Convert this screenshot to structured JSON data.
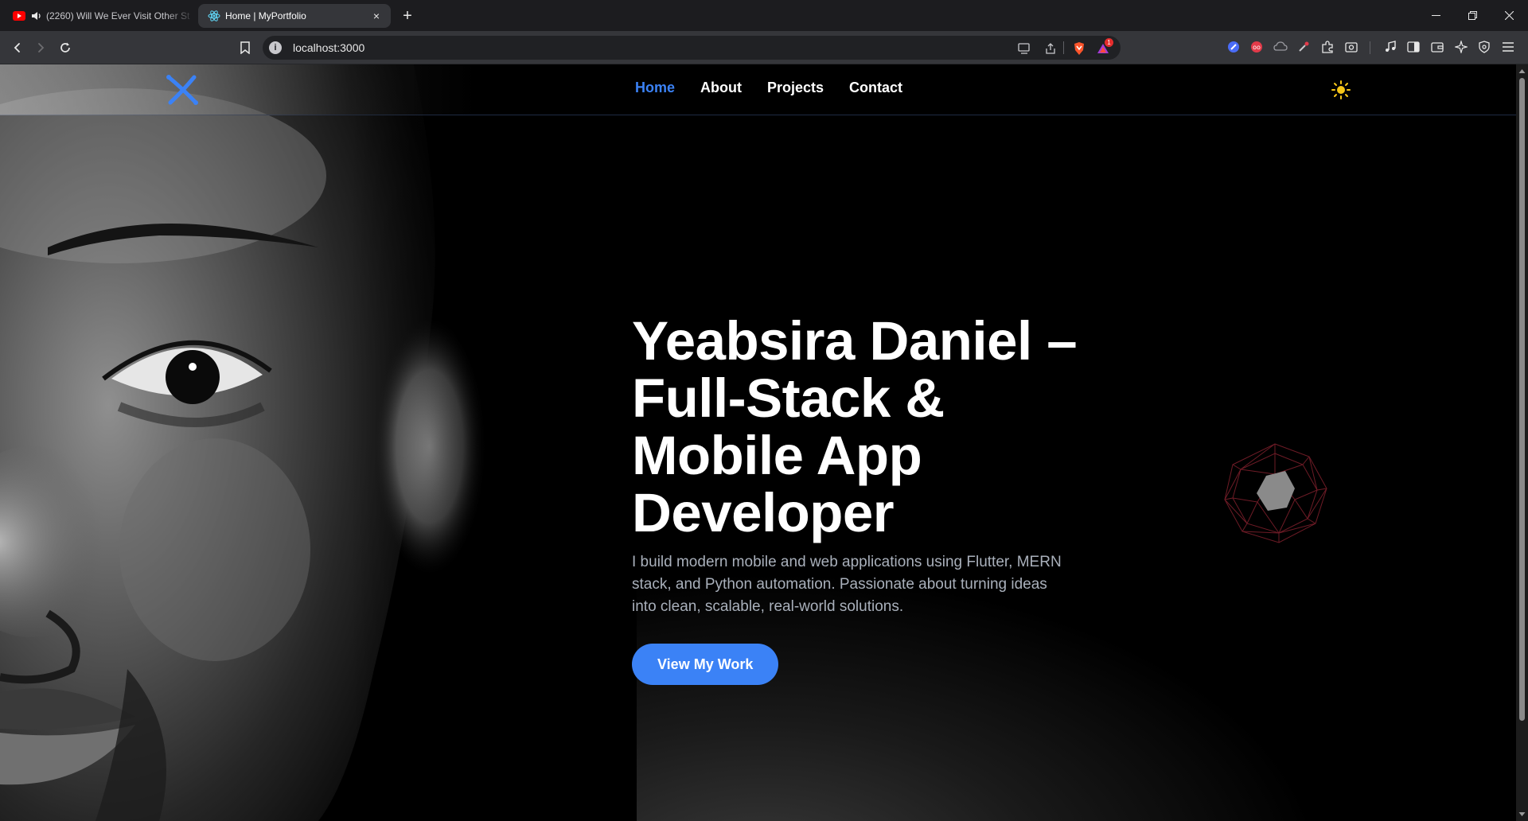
{
  "browser": {
    "tabs": [
      {
        "title": "(2260) Will We Ever Visit Other St",
        "icon": "youtube-icon",
        "audio_icon": "speaker-icon"
      },
      {
        "title": "Home | MyPortfolio",
        "icon": "react-icon",
        "close": "×"
      }
    ],
    "new_tab": "+",
    "url": "localhost:3000",
    "notification_count": "1",
    "window_controls": [
      "minimize-icon",
      "restore-icon",
      "close-icon"
    ]
  },
  "site": {
    "nav": [
      {
        "label": "Home",
        "active": true
      },
      {
        "label": "About"
      },
      {
        "label": "Projects"
      },
      {
        "label": "Contact"
      }
    ],
    "theme_icon": "sun-icon",
    "hero": {
      "title": "Yeabsira Daniel – Full-Stack & Mobile App Developer",
      "description": "I build modern mobile and web applications using Flutter, MERN stack, and Python automation. Passionate about turning ideas into clean, scalable, real-world solutions.",
      "cta": "View My Work"
    }
  },
  "colors": {
    "accent": "#3b82f6",
    "background": "#000000",
    "muted_text": "#a9b0bb",
    "polyhedron": "#7a1f2b"
  }
}
